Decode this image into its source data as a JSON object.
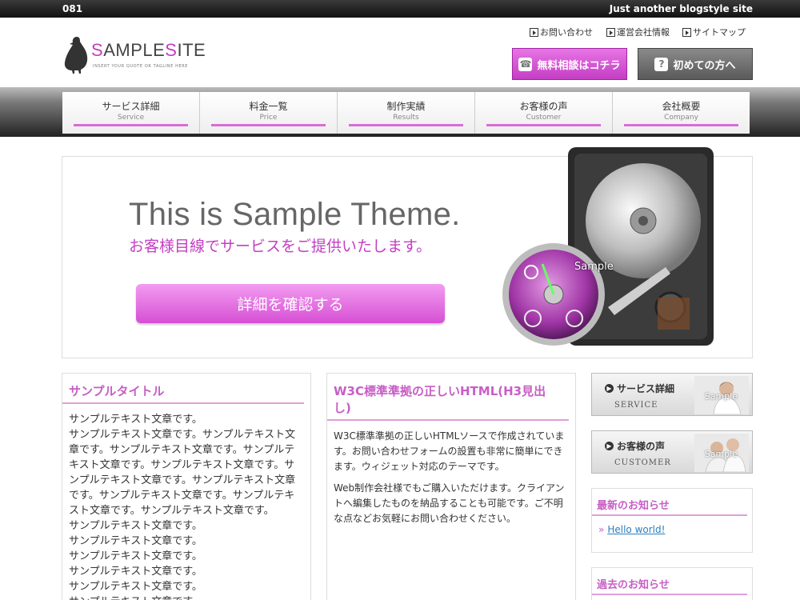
{
  "topbar": {
    "left": "081",
    "right": "Just another blogstyle site"
  },
  "logo": {
    "brand_s": "S",
    "brand_ample": "AMPLE",
    "brand_s2": "S",
    "brand_ite": "ITE",
    "tagline": "INSERT YOUR QUOTE OR TAGLINE HERE"
  },
  "util_links": [
    "お問い合わせ",
    "運営会社情報",
    "サイトマップ"
  ],
  "header_buttons": {
    "free": "無料相談はコチラ",
    "first": "初めての方へ"
  },
  "nav": [
    {
      "jp": "サービス詳細",
      "en": "Service"
    },
    {
      "jp": "料金一覧",
      "en": "Price"
    },
    {
      "jp": "制作実績",
      "en": "Results"
    },
    {
      "jp": "お客様の声",
      "en": "Customer"
    },
    {
      "jp": "会社概要",
      "en": "Company"
    }
  ],
  "hero": {
    "title": "This is Sample Theme.",
    "subtitle": "お客様目線でサービスをご提供いたします。",
    "cta": "詳細を確認する",
    "watermark": "Sample"
  },
  "col1": {
    "title": "サンプルタイトル",
    "text": "サンプルテキスト文章です。\nサンプルテキスト文章です。サンプルテキスト文章です。サンプルテキスト文章です。サンプルテキスト文章です。サンプルテキスト文章です。サンプルテキスト文章です。サンプルテキスト文章です。サンプルテキスト文章です。サンプルテキスト文章です。サンプルテキスト文章です。\nサンプルテキスト文章です。\nサンプルテキスト文章です。\nサンプルテキスト文章です。\nサンプルテキスト文章です。\nサンプルテキスト文章です。\nサンプルテキスト文章です。"
  },
  "col2": {
    "title": "W3C標準準拠の正しいHTML(H3見出し)",
    "p1": "W3C標準準拠の正しいHTMLソースで作成されています。お問い合わせフォームの設置も非常に簡単にできます。ウィジェット対応のテーマです。",
    "p2": "Web制作会社様でもご購入いただけます。クライアントへ編集したものを納品することも可能です。ご不明な点などお気軽にお問い合わせください。"
  },
  "side": {
    "banner1": {
      "title": "サービス詳細",
      "sub": "SERVICE",
      "wm": "Sample"
    },
    "banner2": {
      "title": "お客様の声",
      "sub": "CUSTOMER",
      "wm": "Sample"
    },
    "news": {
      "title": "最新のお知らせ",
      "link": "Hello world!"
    },
    "past": {
      "title": "過去のお知らせ"
    }
  },
  "colors": {
    "accent": "#c43ec4",
    "heading": "#c75ec5",
    "link": "#2a7fbf"
  }
}
